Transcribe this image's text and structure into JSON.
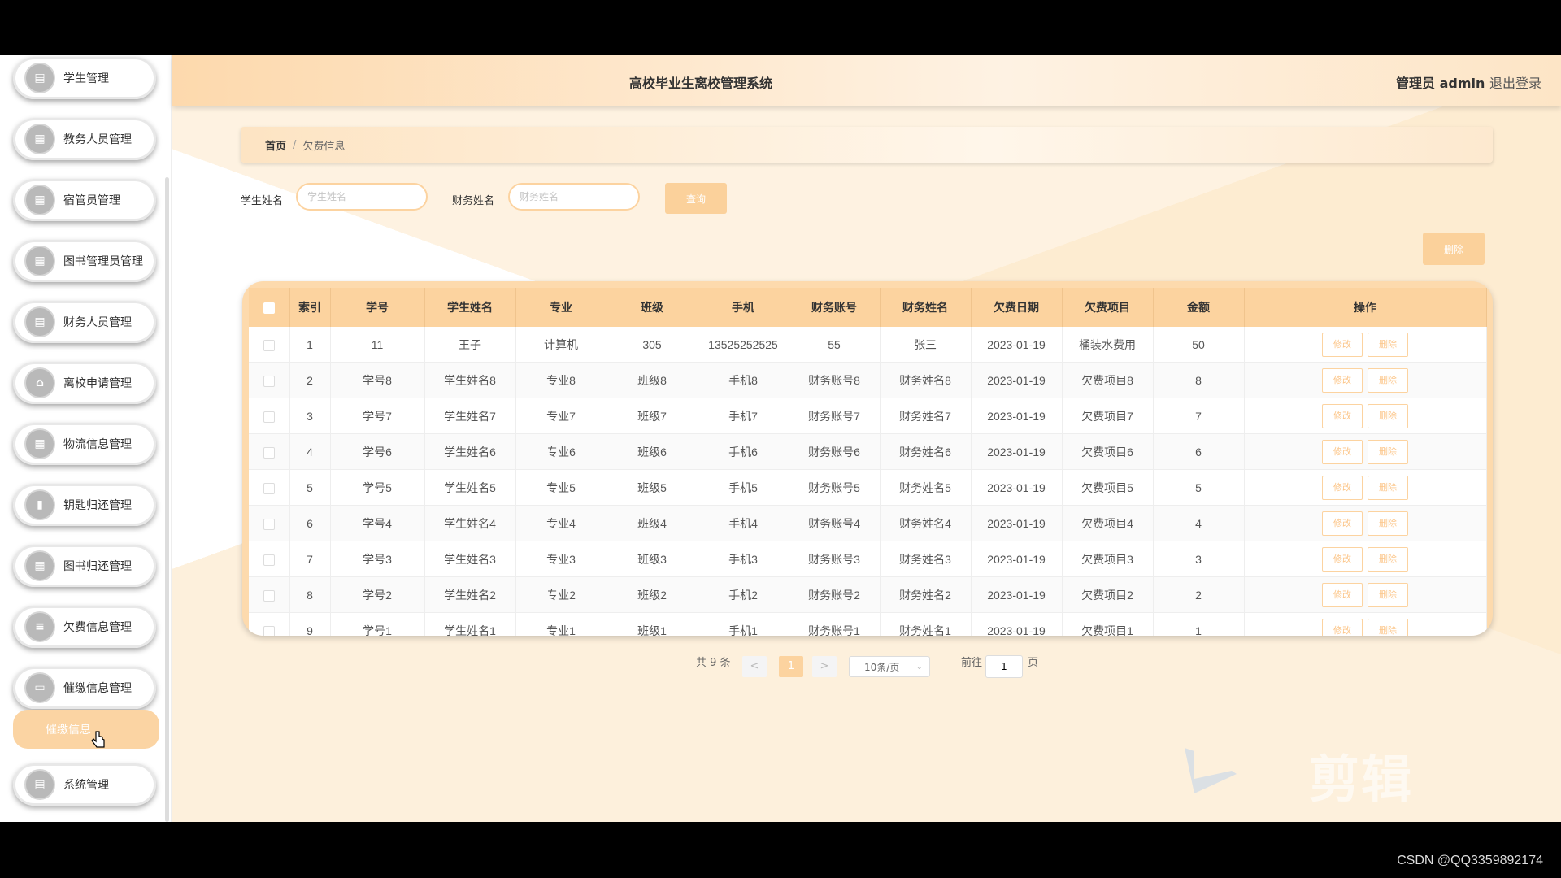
{
  "app": {
    "title": "高校毕业生离校管理系统",
    "admin_label": "管理员 admin",
    "logout": "退出登录"
  },
  "sidebar": {
    "items": [
      {
        "label": "学生管理",
        "icon": "doc-icon"
      },
      {
        "label": "教务人员管理",
        "icon": "grid-icon"
      },
      {
        "label": "宿管员管理",
        "icon": "grid-icon"
      },
      {
        "label": "图书管理员管理",
        "icon": "grid-icon"
      },
      {
        "label": "财务人员管理",
        "icon": "doc-icon"
      },
      {
        "label": "离校申请管理",
        "icon": "shop-icon"
      },
      {
        "label": "物流信息管理",
        "icon": "grid-icon"
      },
      {
        "label": "钥匙归还管理",
        "icon": "bar-chart-icon"
      },
      {
        "label": "图书归还管理",
        "icon": "grid-icon"
      },
      {
        "label": "欠费信息管理",
        "icon": "list-icon"
      },
      {
        "label": "催缴信息管理",
        "icon": "monitor-icon"
      }
    ],
    "active_sub": "催缴信息",
    "last_item": {
      "label": "系统管理",
      "icon": "doc-icon"
    }
  },
  "breadcrumb": {
    "home": "首页",
    "sep": "/",
    "current": "欠费信息"
  },
  "search": {
    "student_label": "学生姓名",
    "student_placeholder": "学生姓名",
    "finance_label": "财务姓名",
    "finance_placeholder": "财务姓名",
    "query_button": "查询"
  },
  "toolbar": {
    "delete_button": "删除"
  },
  "table": {
    "headers": [
      "索引",
      "学号",
      "学生姓名",
      "专业",
      "班级",
      "手机",
      "财务账号",
      "财务姓名",
      "欠费日期",
      "欠费项目",
      "金额",
      "操作"
    ],
    "edit_label": "修改",
    "delete_label": "删除",
    "rows": [
      [
        "1",
        "11",
        "王子",
        "计算机",
        "305",
        "13525252525",
        "55",
        "张三",
        "2023-01-19",
        "桶装水费用",
        "50"
      ],
      [
        "2",
        "学号8",
        "学生姓名8",
        "专业8",
        "班级8",
        "手机8",
        "财务账号8",
        "财务姓名8",
        "2023-01-19",
        "欠费项目8",
        "8"
      ],
      [
        "3",
        "学号7",
        "学生姓名7",
        "专业7",
        "班级7",
        "手机7",
        "财务账号7",
        "财务姓名7",
        "2023-01-19",
        "欠费项目7",
        "7"
      ],
      [
        "4",
        "学号6",
        "学生姓名6",
        "专业6",
        "班级6",
        "手机6",
        "财务账号6",
        "财务姓名6",
        "2023-01-19",
        "欠费项目6",
        "6"
      ],
      [
        "5",
        "学号5",
        "学生姓名5",
        "专业5",
        "班级5",
        "手机5",
        "财务账号5",
        "财务姓名5",
        "2023-01-19",
        "欠费项目5",
        "5"
      ],
      [
        "6",
        "学号4",
        "学生姓名4",
        "专业4",
        "班级4",
        "手机4",
        "财务账号4",
        "财务姓名4",
        "2023-01-19",
        "欠费项目4",
        "4"
      ],
      [
        "7",
        "学号3",
        "学生姓名3",
        "专业3",
        "班级3",
        "手机3",
        "财务账号3",
        "财务姓名3",
        "2023-01-19",
        "欠费项目3",
        "3"
      ],
      [
        "8",
        "学号2",
        "学生姓名2",
        "专业2",
        "班级2",
        "手机2",
        "财务账号2",
        "财务姓名2",
        "2023-01-19",
        "欠费项目2",
        "2"
      ],
      [
        "9",
        "学号1",
        "学生姓名1",
        "专业1",
        "班级1",
        "手机1",
        "财务账号1",
        "财务姓名1",
        "2023-01-19",
        "欠费项目1",
        "1"
      ]
    ]
  },
  "pagination": {
    "total": "共 9 条",
    "prev": "<",
    "current_page": "1",
    "next": ">",
    "page_size": "10条/页",
    "goto_label": "前往",
    "goto_value": "1",
    "page_suffix": "页"
  },
  "watermark": {
    "text": "剪辑"
  },
  "footer": {
    "credit": "CSDN @QQ3359892174"
  },
  "colors": {
    "accent": "#fcd39f",
    "accent_dark": "#fbd19b",
    "header_from": "#fdd9ad"
  }
}
